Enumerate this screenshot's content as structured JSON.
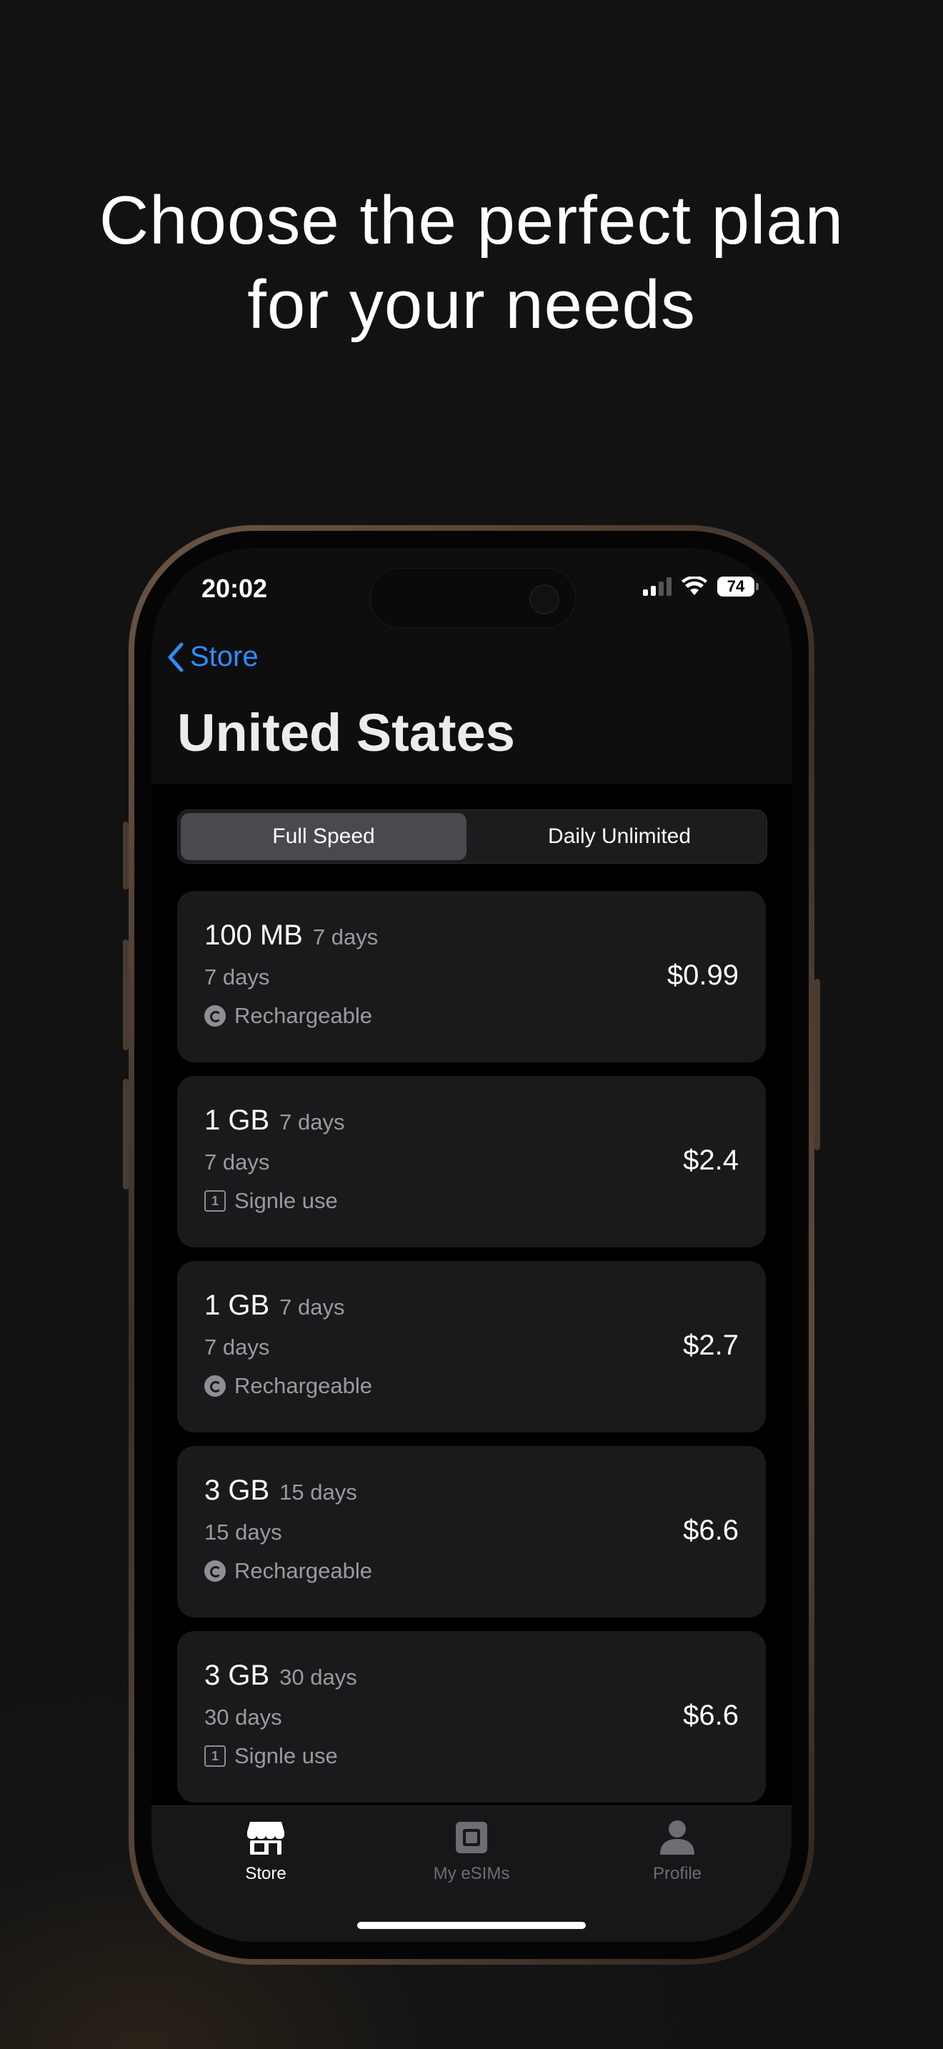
{
  "headline": {
    "line1": "Choose the perfect plan",
    "line2": "for your needs"
  },
  "status_bar": {
    "time": "20:02",
    "battery": "74"
  },
  "nav": {
    "back_label": "Store",
    "title": "United States"
  },
  "segments": {
    "active": "Full Speed",
    "inactive": "Daily Unlimited"
  },
  "plans": [
    {
      "data": "100 MB",
      "validity": "7 days",
      "duration": "7 days",
      "type": "Rechargeable",
      "icon": "recharge-icon",
      "price": "$0.99"
    },
    {
      "data": "1 GB",
      "validity": "7 days",
      "duration": "7 days",
      "type": "Signle use",
      "icon": "single-use-icon",
      "price": "$2.4"
    },
    {
      "data": "1 GB",
      "validity": "7 days",
      "duration": "7 days",
      "type": "Rechargeable",
      "icon": "recharge-icon",
      "price": "$2.7"
    },
    {
      "data": "3 GB",
      "validity": "15 days",
      "duration": "15 days",
      "type": "Rechargeable",
      "icon": "recharge-icon",
      "price": "$6.6"
    },
    {
      "data": "3 GB",
      "validity": "30 days",
      "duration": "30 days",
      "type": "Signle use",
      "icon": "single-use-icon",
      "price": "$6.6"
    }
  ],
  "tabs": [
    {
      "label": "Store",
      "icon": "store-icon",
      "active": true
    },
    {
      "label": "My eSIMs",
      "icon": "sim-card-icon",
      "active": false
    },
    {
      "label": "Profile",
      "icon": "person-icon",
      "active": false
    }
  ],
  "colors": {
    "accent": "#2f8cff",
    "background": "#121212",
    "card": "#1a1a1c"
  }
}
